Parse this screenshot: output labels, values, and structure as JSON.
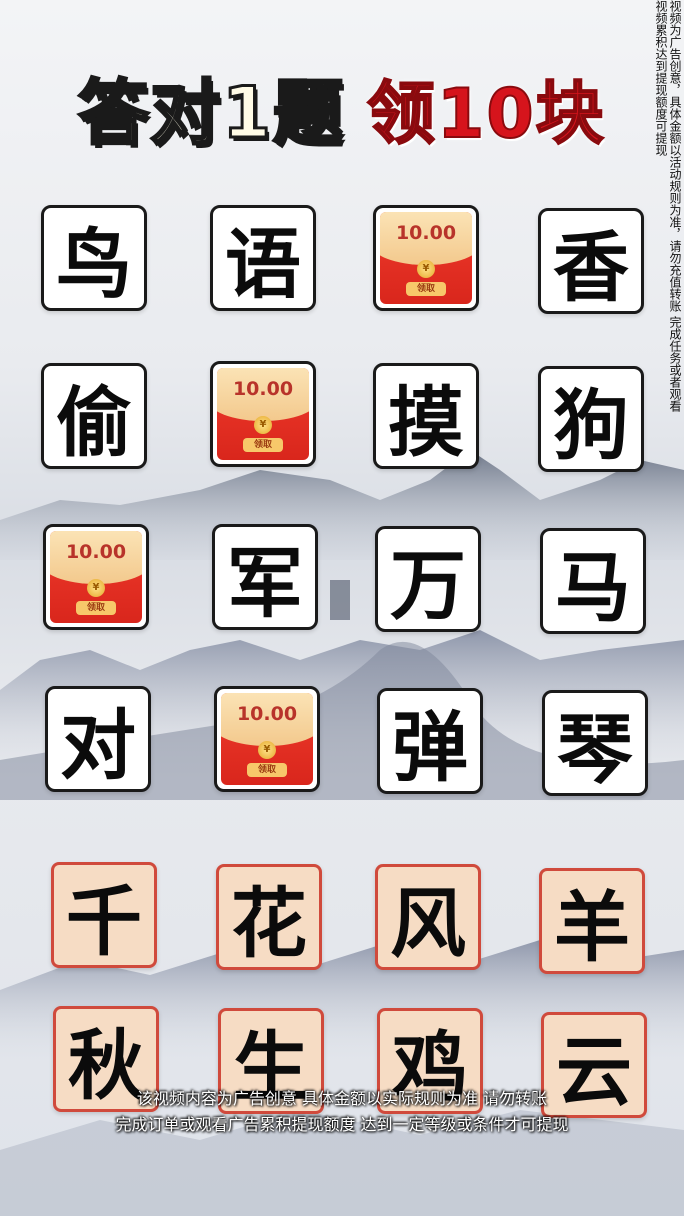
{
  "title": {
    "left": "答对1题",
    "right": "领10块"
  },
  "side_notice": "视频为广告创意，具体金额以活动规则为准，请勿充值转账 完成任务或者观看视频累积达到提现额度可提现",
  "grid": {
    "rows": [
      [
        {
          "type": "char",
          "text": "鸟"
        },
        {
          "type": "char",
          "text": "语"
        },
        {
          "type": "redpacket",
          "amount": "10.00",
          "claim": "领取"
        },
        {
          "type": "char",
          "text": "香"
        }
      ],
      [
        {
          "type": "char",
          "text": "偷"
        },
        {
          "type": "redpacket",
          "amount": "10.00",
          "claim": "领取"
        },
        {
          "type": "char",
          "text": "摸"
        },
        {
          "type": "char",
          "text": "狗"
        }
      ],
      [
        {
          "type": "redpacket",
          "amount": "10.00",
          "claim": "领取"
        },
        {
          "type": "char",
          "text": "军"
        },
        {
          "type": "char",
          "text": "万"
        },
        {
          "type": "char",
          "text": "马"
        }
      ],
      [
        {
          "type": "char",
          "text": "对"
        },
        {
          "type": "redpacket",
          "amount": "10.00",
          "claim": "领取"
        },
        {
          "type": "char",
          "text": "弹"
        },
        {
          "type": "char",
          "text": "琴"
        }
      ]
    ]
  },
  "answers": {
    "row1": [
      "千",
      "花",
      "风",
      "羊"
    ],
    "row2": [
      "秋",
      "生",
      "鸡",
      "云"
    ]
  },
  "captions": {
    "line1": "该视频内容为广告创意 具体金额以实际规则为准 请勿转账",
    "line2": "完成订单或观看广告累积提现额度 达到一定等级或条件才可提现"
  },
  "colors": {
    "title_red": "#d6141c",
    "answer_bg": "#f6dcc4",
    "answer_border": "#d04a3c",
    "packet_red": "#e4301f"
  }
}
